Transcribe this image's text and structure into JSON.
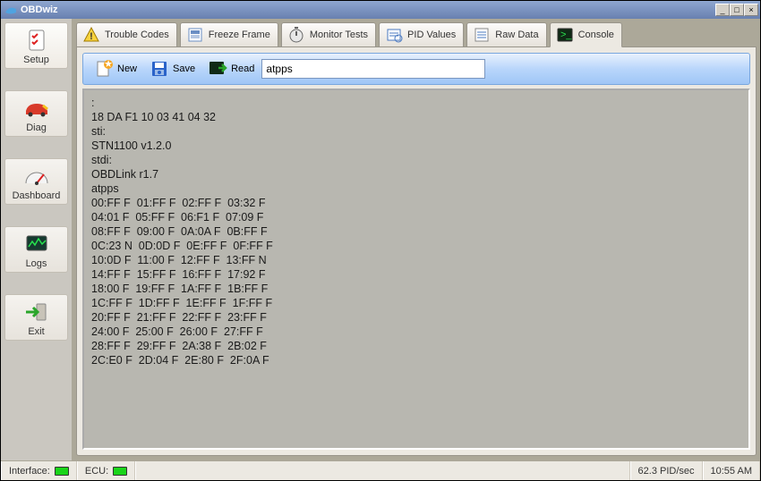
{
  "window": {
    "title": "OBDwiz"
  },
  "sidebar": {
    "items": [
      {
        "label": "Setup",
        "icon": "checklist-icon"
      },
      {
        "label": "Diag",
        "icon": "car-icon"
      },
      {
        "label": "Dashboard",
        "icon": "gauge-icon"
      },
      {
        "label": "Logs",
        "icon": "monitor-icon"
      },
      {
        "label": "Exit",
        "icon": "exit-arrow-icon"
      }
    ]
  },
  "tabs": [
    {
      "label": "Trouble Codes",
      "icon": "warning-icon"
    },
    {
      "label": "Freeze Frame",
      "icon": "snapshot-icon"
    },
    {
      "label": "Monitor Tests",
      "icon": "stopwatch-icon"
    },
    {
      "label": "PID Values",
      "icon": "pid-icon"
    },
    {
      "label": "Raw Data",
      "icon": "rawdata-icon"
    },
    {
      "label": "Console",
      "icon": "terminal-icon",
      "active": true
    }
  ],
  "toolbar": {
    "new_label": "New",
    "save_label": "Save",
    "read_label": "Read",
    "input_value": "atpps"
  },
  "console_text": ":\n18 DA F1 10 03 41 04 32\nsti:\nSTN1100 v1.2.0\nstdi:\nOBDLink r1.7\natpps\n00:FF F  01:FF F  02:FF F  03:32 F\n04:01 F  05:FF F  06:F1 F  07:09 F\n08:FF F  09:00 F  0A:0A F  0B:FF F\n0C:23 N  0D:0D F  0E:FF F  0F:FF F\n10:0D F  11:00 F  12:FF F  13:FF N\n14:FF F  15:FF F  16:FF F  17:92 F\n18:00 F  19:FF F  1A:FF F  1B:FF F\n1C:FF F  1D:FF F  1E:FF F  1F:FF F\n20:FF F  21:FF F  22:FF F  23:FF F\n24:00 F  25:00 F  26:00 F  27:FF F\n28:FF F  29:FF F  2A:38 F  2B:02 F\n2C:E0 F  2D:04 F  2E:80 F  2F:0A F",
  "status": {
    "interface_label": "Interface:",
    "ecu_label": "ECU:",
    "pid_rate": "62.3 PID/sec",
    "clock": "10:55 AM"
  }
}
